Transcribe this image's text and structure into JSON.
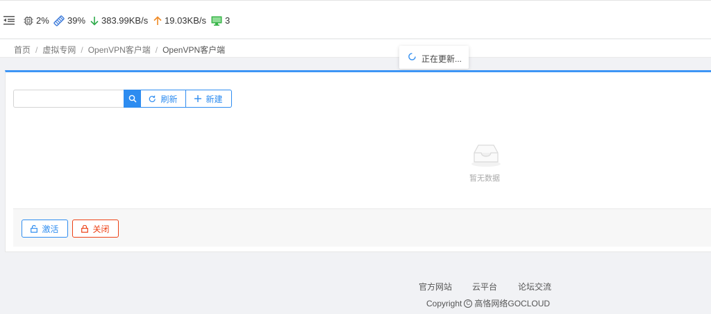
{
  "header": {
    "stats": {
      "cpu": "2%",
      "memory": "39%",
      "download": "383.99KB/s",
      "upload": "19.03KB/s",
      "devices": "3"
    }
  },
  "breadcrumb": {
    "items": [
      "首页",
      "虚拟专网",
      "OpenVPN客户端",
      "OpenVPN客户端"
    ],
    "separator": "/"
  },
  "toast": {
    "text": "正在更新..."
  },
  "toolbar": {
    "search_placeholder": "",
    "refresh_label": "刷新",
    "new_label": "新建"
  },
  "table": {
    "empty_text": "暂无数据"
  },
  "actions": {
    "activate_label": "激活",
    "close_label": "关闭"
  },
  "footer": {
    "links": [
      "官方网站",
      "云平台",
      "论坛交流"
    ],
    "copyright_prefix": "Copyright",
    "copyright_symbol": "C",
    "copyright_holder": "高恪网络GOCLOUD"
  },
  "colors": {
    "primary": "#2d8cf0",
    "danger": "#ed4014",
    "download_arrow": "#2eab4b",
    "upload_arrow": "#f08a24",
    "device_icon": "#3ab54a"
  }
}
